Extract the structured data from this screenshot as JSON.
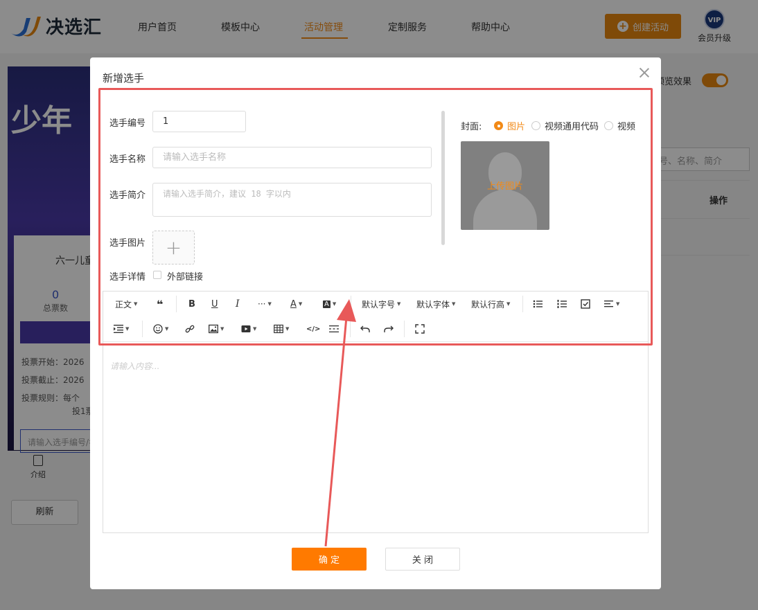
{
  "nav": {
    "logo_text": "决选汇",
    "items": [
      "用户首页",
      "模板中心",
      "活动管理",
      "定制服务",
      "帮助中心"
    ],
    "active_index": 2,
    "create_button": "创建活动",
    "vip_badge": "VIP",
    "vip_label": "会员升级"
  },
  "background": {
    "poster_text": "少年",
    "card_title": "六一儿童",
    "vote_count": "0",
    "vote_count_label": "总票数",
    "info_lines": [
      "投票开始：2026",
      "投票截止：2026",
      "投票规则：每个",
      "投1票"
    ],
    "search_placeholder": "请输入选手编号/名",
    "tab_intro": "介绍",
    "refresh_button": "刷新",
    "preview_label": "预览效果",
    "right_search_placeholder": "号、名称、简介",
    "col_header_op": "操作"
  },
  "modal": {
    "title": "新增选手",
    "fields": {
      "number_label": "选手编号",
      "number_value": "1",
      "name_label": "选手名称",
      "name_placeholder": "请输入选手名称",
      "intro_label": "选手简介",
      "intro_placeholder": "请输入选手简介，建议 18 字以内",
      "image_label": "选手图片",
      "upload_plus": "+",
      "detail_label": "选手详情",
      "external_link_label": "外部链接"
    },
    "cover": {
      "label": "封面:",
      "options": [
        "图片",
        "视频通用代码",
        "视频"
      ],
      "selected_index": 0,
      "upload_text": "上传图片"
    },
    "editor": {
      "toolbar": {
        "paragraph": "正文",
        "quote": "❝",
        "bold": "B",
        "underline": "U",
        "italic": "I",
        "more": "···",
        "font_color": "A",
        "bg_color": "A",
        "font_size": "默认字号",
        "font_family": "默认字体",
        "line_height": "默认行高"
      },
      "placeholder": "请输入内容..."
    },
    "confirm_button": "确 定",
    "close_button": "关 闭"
  },
  "colors": {
    "accent": "#ff7a00",
    "highlight": "#e85959"
  }
}
